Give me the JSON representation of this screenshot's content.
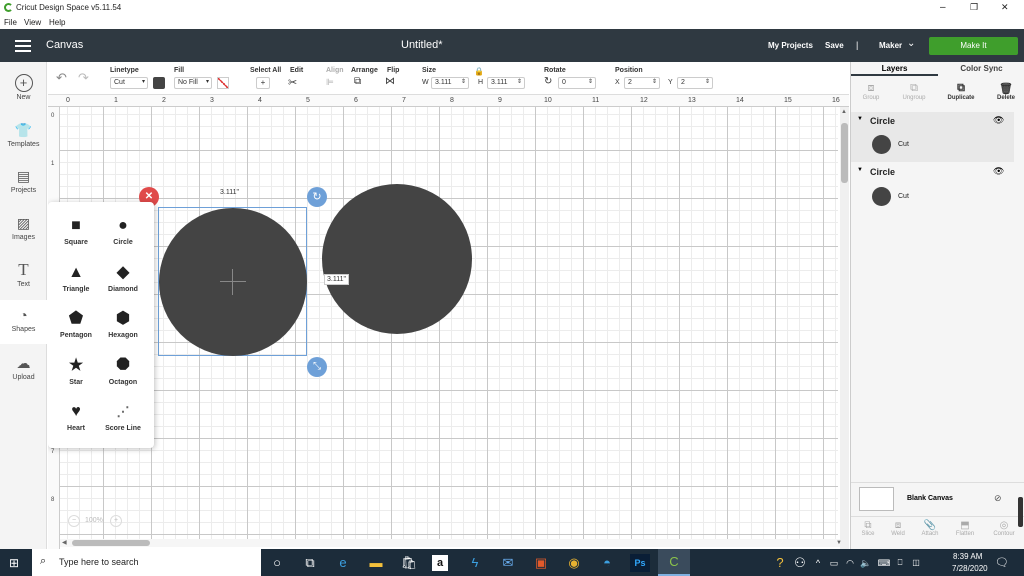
{
  "window": {
    "title": "Cricut Design Space  v5.11.54",
    "minimize": "–",
    "maximize": "❐",
    "close": "✕"
  },
  "menu": {
    "items": [
      "File",
      "View",
      "Help"
    ]
  },
  "header": {
    "page": "Canvas",
    "doc_title": "Untitled*",
    "my_projects": "My Projects",
    "save": "Save",
    "separator": "|",
    "machine": "Maker",
    "make_it": "Make It"
  },
  "toolbar": {
    "linetype_label": "Linetype",
    "linetype_value": "Cut",
    "fill_label": "Fill",
    "fill_value": "No Fill",
    "select_all_label": "Select All",
    "edit_label": "Edit",
    "align_label": "Align",
    "arrange_label": "Arrange",
    "flip_label": "Flip",
    "size_label": "Size",
    "w_label": "W",
    "w_value": "3.111",
    "h_label": "H",
    "h_value": "3.111",
    "rotate_label": "Rotate",
    "rotate_value": "0",
    "position_label": "Position",
    "x_label": "X",
    "x_value": "2",
    "y_label": "Y",
    "y_value": "2"
  },
  "leftbar": {
    "items": [
      {
        "label": "New",
        "icon": "plus-circle-icon"
      },
      {
        "label": "Templates",
        "icon": "shirt-icon"
      },
      {
        "label": "Projects",
        "icon": "projects-icon"
      },
      {
        "label": "Images",
        "icon": "image-icon"
      },
      {
        "label": "Text",
        "icon": "text-icon"
      },
      {
        "label": "Shapes",
        "icon": "shapes-icon"
      },
      {
        "label": "Upload",
        "icon": "cloud-upload-icon"
      }
    ]
  },
  "ruler": {
    "h_ticks": [
      "0",
      "1",
      "2",
      "3",
      "4",
      "5",
      "6",
      "7",
      "8",
      "9",
      "10",
      "11",
      "12",
      "13",
      "14",
      "15",
      "16"
    ],
    "v_ticks": [
      "0",
      "1",
      "7",
      "8"
    ]
  },
  "shapes_panel": {
    "items": [
      "Square",
      "Circle",
      "Triangle",
      "Diamond",
      "Pentagon",
      "Hexagon",
      "Star",
      "Octagon",
      "Heart",
      "Score Line"
    ]
  },
  "canvas": {
    "width_label": "3.111\"",
    "height_label": "3.111\"",
    "zoom": "100%",
    "zoom_out": "−",
    "zoom_in": "+"
  },
  "colors": {
    "shape_fill": "#444444",
    "selection": "#6ea0d8",
    "delete_handle": "#e04a4a",
    "header_bg": "#2f3941",
    "make_it": "#3f9e2c"
  },
  "layers_panel": {
    "tabs": [
      "Layers",
      "Color Sync"
    ],
    "actions": [
      "Group",
      "Ungroup",
      "Duplicate",
      "Delete"
    ],
    "layers": [
      {
        "title": "Circle",
        "sub": "Cut"
      },
      {
        "title": "Circle",
        "sub": "Cut"
      }
    ],
    "blank_canvas": "Blank Canvas",
    "bottom_actions": [
      "Slice",
      "Weld",
      "Attach",
      "Flatten",
      "Contour"
    ]
  },
  "taskbar": {
    "search_placeholder": "Type here to search",
    "time": "8:39 AM",
    "date": "7/28/2020"
  }
}
